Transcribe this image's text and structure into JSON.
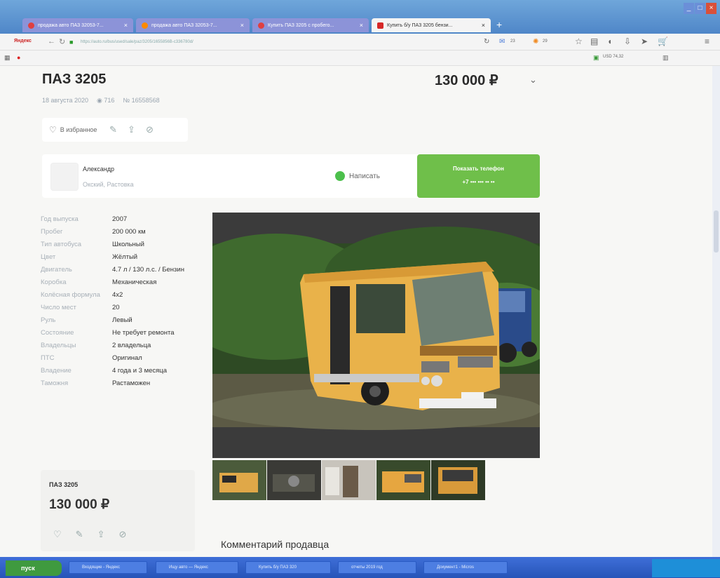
{
  "browser": {
    "tabs": [
      {
        "label": "продажа авто ПАЗ 32053-7...",
        "color": "#e04040"
      },
      {
        "label": "продажа авто ПАЗ 32053-7...",
        "color": "#ff8a00"
      },
      {
        "label": "Купить ПАЗ 3205 с пробего...",
        "color": "#e04040"
      },
      {
        "label": "Купить б/у ПАЗ 3205 бензи...",
        "color": "#d62828"
      }
    ],
    "new_tab_label": "+",
    "url": "https://auto.ru/bus/used/sale/paz/3205/1655856B-c336780d/",
    "logo_text": "Яндекс",
    "toolbar_counts": [
      "23",
      "29"
    ],
    "currency": "USD 74,32"
  },
  "listing": {
    "title": "ПАЗ 3205",
    "price": "130 000 ₽",
    "date": "18 августа 2020",
    "views": "716",
    "number": "№ 16558568",
    "favorite_label": "В избранное"
  },
  "seller": {
    "name": "Александр",
    "location": "Окский, Растовка",
    "write_label": "Написать",
    "show_phone_label": "Показать телефон",
    "phone_masked": "+7 ••• ••• •• ••"
  },
  "specs": [
    {
      "key": "Год выпуска",
      "value": "2007"
    },
    {
      "key": "Пробег",
      "value": "200 000 км"
    },
    {
      "key": "Тип автобуса",
      "value": "Школьный"
    },
    {
      "key": "Цвет",
      "value": "Жёлтый"
    },
    {
      "key": "Двигатель",
      "value": "4.7 л / 130 л.с. / Бензин"
    },
    {
      "key": "Коробка",
      "value": "Механическая"
    },
    {
      "key": "Колёсная формула",
      "value": "4x2"
    },
    {
      "key": "Число мест",
      "value": "20"
    },
    {
      "key": "Руль",
      "value": "Левый"
    },
    {
      "key": "Состояние",
      "value": "Не требует ремонта"
    },
    {
      "key": "Владельцы",
      "value": "2 владельца"
    },
    {
      "key": "ПТС",
      "value": "Оригинал"
    },
    {
      "key": "Владение",
      "value": "4 года и 3 месяца"
    },
    {
      "key": "Таможня",
      "value": "Растаможен"
    }
  ],
  "sticky": {
    "title": "ПАЗ 3205",
    "price": "130 000 ₽"
  },
  "comment_heading": "Комментарий продавца",
  "taskbar": {
    "start_label": "пуск",
    "tasks": [
      "Входящие - Яндекс",
      "Ищу авто — Яндекс",
      "Купить б/у ПАЗ 320",
      "отчеты 2019 год",
      "Документ1 - Micros"
    ]
  },
  "colors": {
    "accent_green": "#6fbf4a",
    "bus_yellow": "#e9b24a"
  }
}
